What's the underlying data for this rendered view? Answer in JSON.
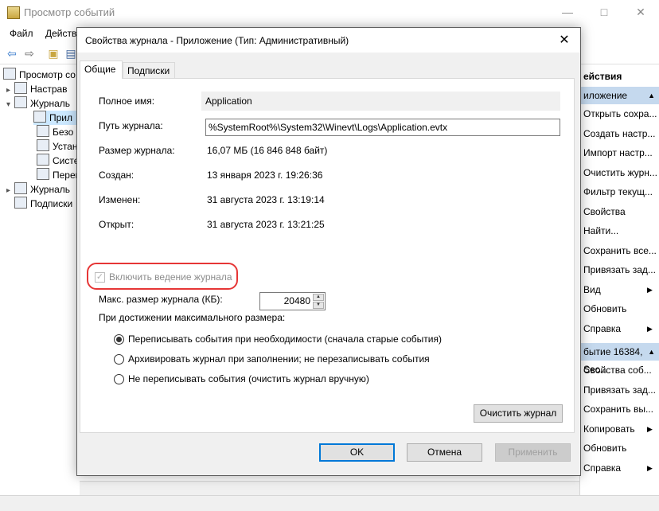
{
  "background_window": {
    "title": "Просмотр событий",
    "menu": [
      "Файл",
      "Действ"
    ],
    "tree": [
      {
        "label": "Просмотр со",
        "arrow": ""
      },
      {
        "label": "Настрав",
        "arrow": "▸"
      },
      {
        "label": "Журналь",
        "arrow": "▾"
      },
      {
        "label": "Прил",
        "arrow": ""
      },
      {
        "label": "Безо",
        "arrow": ""
      },
      {
        "label": "Устан",
        "arrow": ""
      },
      {
        "label": "Систе",
        "arrow": ""
      },
      {
        "label": "Перен",
        "arrow": ""
      },
      {
        "label": "Журналь",
        "arrow": "▸"
      },
      {
        "label": "Подписки",
        "arrow": ""
      }
    ],
    "actions_header_top": "ействия",
    "actions_group1_header": "иложение",
    "actions_group1": [
      {
        "label": "Открыть сохра...",
        "sub": false
      },
      {
        "label": "Создать настр...",
        "sub": false
      },
      {
        "label": "Импорт настр...",
        "sub": false
      },
      {
        "label": "Очистить журн...",
        "sub": false
      },
      {
        "label": "Фильтр текущ...",
        "sub": false
      },
      {
        "label": "Свойства",
        "sub": false
      },
      {
        "label": "Найти...",
        "sub": false
      },
      {
        "label": "Сохранить все...",
        "sub": false
      },
      {
        "label": "Привязать зад...",
        "sub": false
      },
      {
        "label": "Вид",
        "sub": true
      },
      {
        "label": "Обновить",
        "sub": false
      },
      {
        "label": "Справка",
        "sub": true
      }
    ],
    "actions_group2_header": "бытие 16384, Sec...",
    "actions_group2": [
      {
        "label": "Свойства соб...",
        "sub": false
      },
      {
        "label": "Привязать зад...",
        "sub": false
      },
      {
        "label": "Сохранить вы...",
        "sub": false
      },
      {
        "label": "Копировать",
        "sub": true
      },
      {
        "label": "Обновить",
        "sub": false
      },
      {
        "label": "Справка",
        "sub": true
      }
    ]
  },
  "dialog": {
    "title": "Свойства журнала - Приложение (Тип: Административный)",
    "tabs": [
      "Общие",
      "Подписки"
    ],
    "fields": {
      "full_name_label": "Полное имя:",
      "full_name_value": "Application",
      "path_label": "Путь журнала:",
      "path_value": "%SystemRoot%\\System32\\Winevt\\Logs\\Application.evtx",
      "size_label": "Размер журнала:",
      "size_value": "16,07 МБ (16 846 848 байт)",
      "created_label": "Создан:",
      "created_value": "13 января 2023 г. 19:26:36",
      "modified_label": "Изменен:",
      "modified_value": "31 августа 2023 г. 13:19:14",
      "opened_label": "Открыт:",
      "opened_value": "31 августа 2023 г. 13:21:25"
    },
    "enable_logging_label": "Включить ведение журнала",
    "enable_logging_checked": true,
    "max_size_label": "Макс. размер журнала (КБ):",
    "max_size_value": "20480",
    "on_max_label": "При достижении максимального размера:",
    "radio_options": [
      {
        "label": "Переписывать события при необходимости (сначала старые события)",
        "checked": true
      },
      {
        "label": "Архивировать журнал при заполнении; не перезаписывать события",
        "checked": false
      },
      {
        "label": "Не переписывать события (очистить журнал вручную)",
        "checked": false
      }
    ],
    "clear_log_button": "Очистить журнал",
    "ok_button": "OK",
    "cancel_button": "Отмена",
    "apply_button": "Применить"
  },
  "colors": {
    "highlight_ring": "#e63636",
    "selection": "#cce8ff",
    "actions_header": "#c5d9ee"
  }
}
